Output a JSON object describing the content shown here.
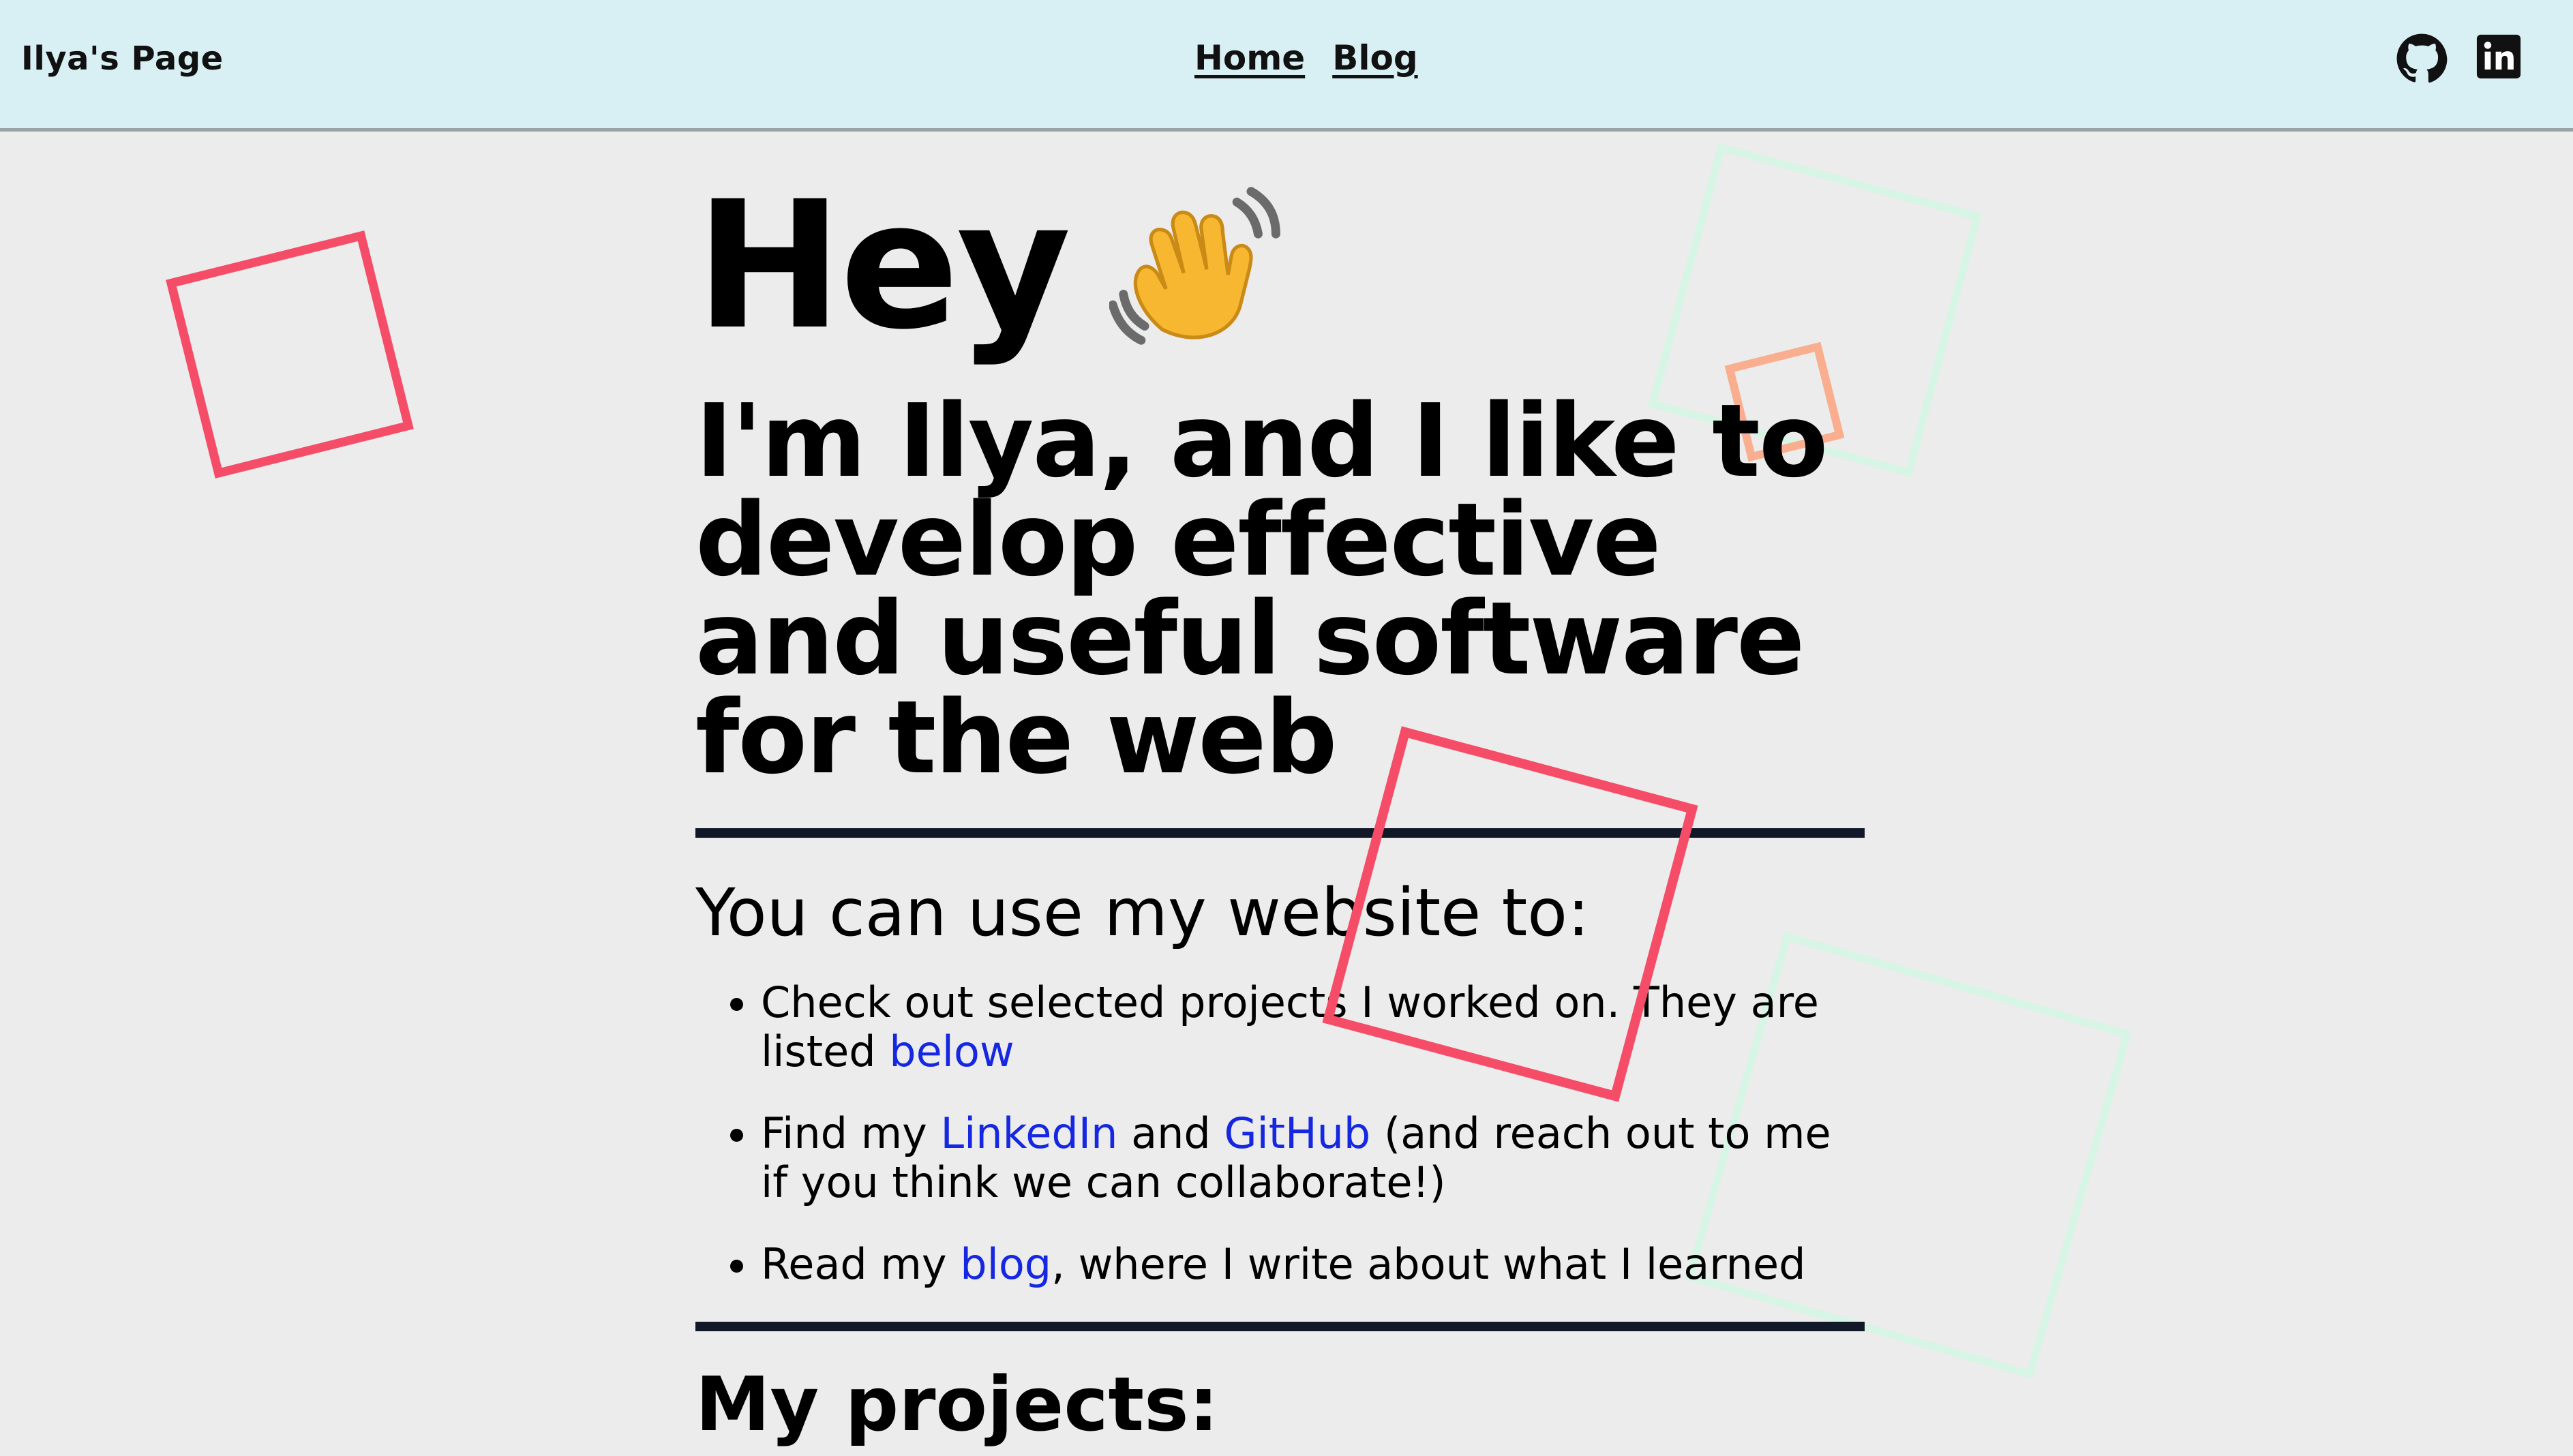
{
  "header": {
    "brand": "Ilya's Page",
    "nav": [
      {
        "label": "Home"
      },
      {
        "label": "Blog"
      }
    ],
    "social": [
      {
        "icon": "github-icon"
      },
      {
        "icon": "linkedin-icon"
      }
    ]
  },
  "hero": {
    "greeting": "Hey",
    "greeting_icon": "waving-hand-icon",
    "intro": "I'm Ilya, and I like to develop effective and useful software for the web"
  },
  "uses": {
    "heading": "You can use my website to:",
    "items": [
      {
        "pre": "Check out selected projects I worked on. They are listed ",
        "link": "below",
        "post": ""
      },
      {
        "pre": "Find my ",
        "link1": "LinkedIn",
        "mid": " and ",
        "link2": "GitHub",
        "post": " (and reach out to me if you think we can collaborate!)"
      },
      {
        "pre": "Read my ",
        "link": "blog",
        "post": ", where I write about what I learned"
      }
    ]
  },
  "projects": {
    "heading": "My projects:"
  },
  "colors": {
    "header_bg": "#d8f0f4",
    "page_bg": "#ececec",
    "link": "#1527e0",
    "shape_red": "#f54d68",
    "shape_green": "#d6f5e4",
    "shape_orange": "#f9ae8f",
    "rule": "#111827"
  }
}
